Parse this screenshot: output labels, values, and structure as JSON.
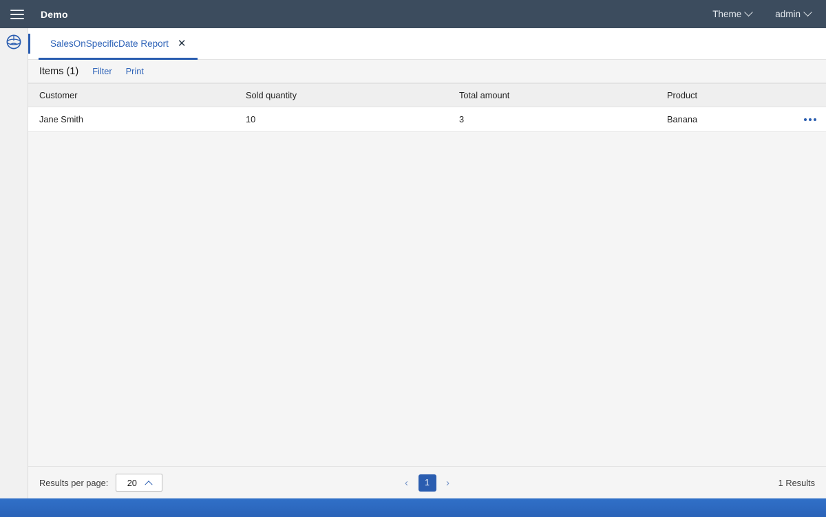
{
  "topbar": {
    "menu_icon": "hamburger-icon",
    "brand": "Demo",
    "theme_label": "Theme",
    "user_label": "admin",
    "background": "#3c4c5e"
  },
  "sidebar": {
    "icon": "app-globe-icon"
  },
  "tabs": [
    {
      "label": "SalesOnSpecificDate Report",
      "close_label": "✕",
      "active": true
    }
  ],
  "toolbar": {
    "title": "Items (1)",
    "filter_label": "Filter",
    "print_label": "Print"
  },
  "table": {
    "columns": [
      "Customer",
      "Sold quantity",
      "Total amount",
      "Product"
    ],
    "rows": [
      {
        "customer": "Jane Smith",
        "sold_quantity": "10",
        "total_amount": "3",
        "product": "Banana",
        "actions_icon": "kebab-menu-icon"
      }
    ]
  },
  "footer": {
    "results_per_page_label": "Results per page:",
    "results_per_page_value": "20",
    "prev_label": "‹",
    "next_label": "›",
    "current_page": "1",
    "results_count": "1 Results"
  },
  "colors": {
    "accent_blue": "#2a5db0",
    "link_blue": "#2e63b8",
    "navbar": "#3c4c5e",
    "bottom_strip": "#2b6cc4"
  }
}
